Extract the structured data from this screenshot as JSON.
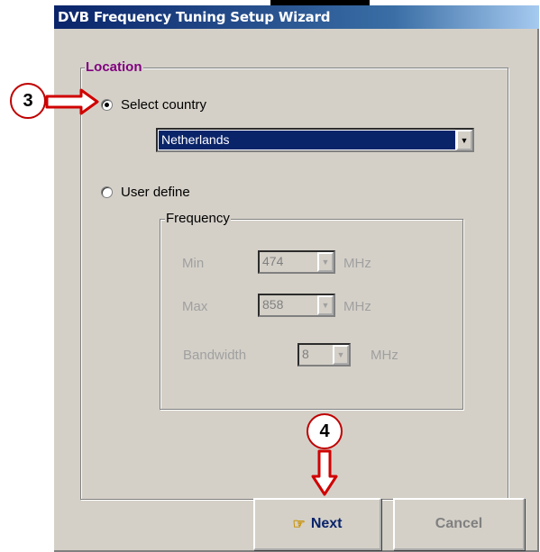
{
  "window": {
    "title": "DVB Frequency Tuning Setup Wizard"
  },
  "location": {
    "legend": "Location",
    "select_country_label": "Select country",
    "country_value": "Netherlands",
    "user_define_label": "User define"
  },
  "frequency": {
    "legend": "Frequency",
    "min_label": "Min",
    "min_value": "474",
    "max_label": "Max",
    "max_value": "858",
    "bandwidth_label": "Bandwidth",
    "bandwidth_value": "8",
    "unit": "MHz"
  },
  "buttons": {
    "next": "Next",
    "cancel": "Cancel"
  },
  "callouts": {
    "step3": "3",
    "step4": "4"
  },
  "colors": {
    "legend": "#800080",
    "callout_border": "#c00000",
    "arrow": "#d00000"
  }
}
